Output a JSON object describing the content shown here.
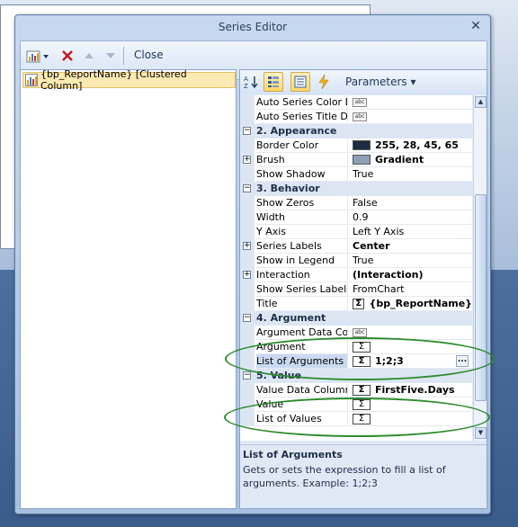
{
  "dialog": {
    "title": "Series Editor",
    "close_glyph": "✕"
  },
  "toolbar": {
    "close_label": "Close"
  },
  "series_list": [
    {
      "label": "{bp_ReportName} [Clustered Column]",
      "icon": "column-chart-icon"
    }
  ],
  "prop_toolbar": {
    "parameters_label": "Parameters ▾"
  },
  "properties": [
    {
      "kind": "prop",
      "name": "Auto Series Color Da",
      "value": "",
      "editor": "abc"
    },
    {
      "kind": "prop",
      "name": "Auto Series Title Data",
      "value": "",
      "editor": "abc"
    },
    {
      "kind": "cat",
      "name": "2. Appearance"
    },
    {
      "kind": "prop",
      "name": "Border Color",
      "value": "255, 28, 45, 65",
      "editor": "swatch",
      "swatch": "#1c2d41",
      "bold": true
    },
    {
      "kind": "prop",
      "name": "Brush",
      "value": "Gradient",
      "editor": "swatch",
      "swatch": "#8ea0b8",
      "bold": true,
      "expand": true
    },
    {
      "kind": "prop",
      "name": "Show Shadow",
      "value": "True"
    },
    {
      "kind": "cat",
      "name": "3. Behavior"
    },
    {
      "kind": "prop",
      "name": "Show Zeros",
      "value": "False"
    },
    {
      "kind": "prop",
      "name": "Width",
      "value": "0.9"
    },
    {
      "kind": "prop",
      "name": "Y Axis",
      "value": "Left Y Axis"
    },
    {
      "kind": "prop",
      "name": "Series Labels",
      "value": "Center",
      "bold": true,
      "expand": true
    },
    {
      "kind": "prop",
      "name": "Show in Legend",
      "value": "True"
    },
    {
      "kind": "prop",
      "name": "Interaction",
      "value": "(Interaction)",
      "bold": true,
      "expand": true
    },
    {
      "kind": "prop",
      "name": "Show Series Labels",
      "value": "FromChart"
    },
    {
      "kind": "prop",
      "name": "Title",
      "value": "{bp_ReportName}",
      "editor": "sigma",
      "bold": true
    },
    {
      "kind": "cat",
      "name": "4. Argument"
    },
    {
      "kind": "prop",
      "name": "Argument Data Column",
      "value": "",
      "editor": "abc"
    },
    {
      "kind": "prop",
      "name": "Argument",
      "value": "",
      "editor": "sigma"
    },
    {
      "kind": "prop",
      "name": "List of Arguments",
      "value": "1;2;3",
      "editor": "sigma",
      "bold": true,
      "selected": true,
      "ellipsis": "..."
    },
    {
      "kind": "cat",
      "name": "5. Value"
    },
    {
      "kind": "prop",
      "name": "Value Data Column",
      "value": "FirstFive.Days",
      "editor": "sigma",
      "bold": true
    },
    {
      "kind": "prop",
      "name": "Value",
      "value": "",
      "editor": "sigma"
    },
    {
      "kind": "prop",
      "name": "List of Values",
      "value": "",
      "editor": "sigma"
    }
  ],
  "description": {
    "title": "List of Arguments",
    "text": "Gets or sets the expression to fill a list of arguments. Example: 1;2;3"
  },
  "colors": {
    "highlight_ellipse": "#2e8b2e",
    "selection": "#c9daf0"
  }
}
